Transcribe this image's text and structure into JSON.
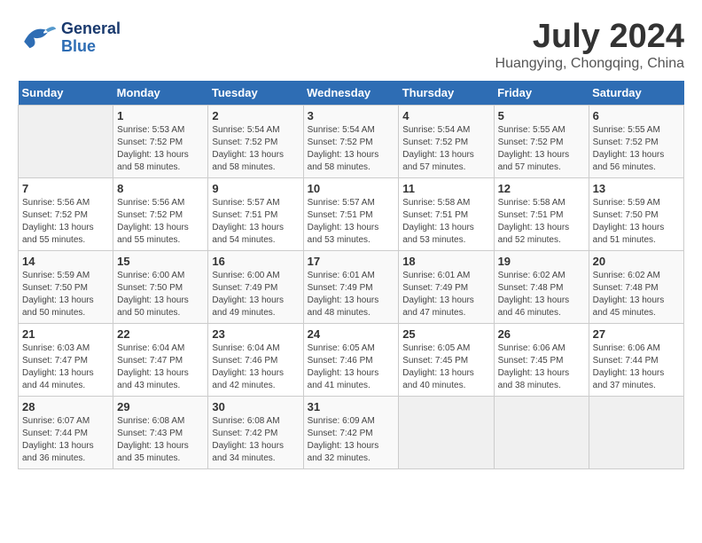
{
  "header": {
    "logo_general": "General",
    "logo_blue": "Blue",
    "month": "July 2024",
    "location": "Huangying, Chongqing, China"
  },
  "weekdays": [
    "Sunday",
    "Monday",
    "Tuesday",
    "Wednesday",
    "Thursday",
    "Friday",
    "Saturday"
  ],
  "weeks": [
    [
      {
        "day": "",
        "info": ""
      },
      {
        "day": "1",
        "info": "Sunrise: 5:53 AM\nSunset: 7:52 PM\nDaylight: 13 hours\nand 58 minutes."
      },
      {
        "day": "2",
        "info": "Sunrise: 5:54 AM\nSunset: 7:52 PM\nDaylight: 13 hours\nand 58 minutes."
      },
      {
        "day": "3",
        "info": "Sunrise: 5:54 AM\nSunset: 7:52 PM\nDaylight: 13 hours\nand 58 minutes."
      },
      {
        "day": "4",
        "info": "Sunrise: 5:54 AM\nSunset: 7:52 PM\nDaylight: 13 hours\nand 57 minutes."
      },
      {
        "day": "5",
        "info": "Sunrise: 5:55 AM\nSunset: 7:52 PM\nDaylight: 13 hours\nand 57 minutes."
      },
      {
        "day": "6",
        "info": "Sunrise: 5:55 AM\nSunset: 7:52 PM\nDaylight: 13 hours\nand 56 minutes."
      }
    ],
    [
      {
        "day": "7",
        "info": "Sunrise: 5:56 AM\nSunset: 7:52 PM\nDaylight: 13 hours\nand 55 minutes."
      },
      {
        "day": "8",
        "info": "Sunrise: 5:56 AM\nSunset: 7:52 PM\nDaylight: 13 hours\nand 55 minutes."
      },
      {
        "day": "9",
        "info": "Sunrise: 5:57 AM\nSunset: 7:51 PM\nDaylight: 13 hours\nand 54 minutes."
      },
      {
        "day": "10",
        "info": "Sunrise: 5:57 AM\nSunset: 7:51 PM\nDaylight: 13 hours\nand 53 minutes."
      },
      {
        "day": "11",
        "info": "Sunrise: 5:58 AM\nSunset: 7:51 PM\nDaylight: 13 hours\nand 53 minutes."
      },
      {
        "day": "12",
        "info": "Sunrise: 5:58 AM\nSunset: 7:51 PM\nDaylight: 13 hours\nand 52 minutes."
      },
      {
        "day": "13",
        "info": "Sunrise: 5:59 AM\nSunset: 7:50 PM\nDaylight: 13 hours\nand 51 minutes."
      }
    ],
    [
      {
        "day": "14",
        "info": "Sunrise: 5:59 AM\nSunset: 7:50 PM\nDaylight: 13 hours\nand 50 minutes."
      },
      {
        "day": "15",
        "info": "Sunrise: 6:00 AM\nSunset: 7:50 PM\nDaylight: 13 hours\nand 50 minutes."
      },
      {
        "day": "16",
        "info": "Sunrise: 6:00 AM\nSunset: 7:49 PM\nDaylight: 13 hours\nand 49 minutes."
      },
      {
        "day": "17",
        "info": "Sunrise: 6:01 AM\nSunset: 7:49 PM\nDaylight: 13 hours\nand 48 minutes."
      },
      {
        "day": "18",
        "info": "Sunrise: 6:01 AM\nSunset: 7:49 PM\nDaylight: 13 hours\nand 47 minutes."
      },
      {
        "day": "19",
        "info": "Sunrise: 6:02 AM\nSunset: 7:48 PM\nDaylight: 13 hours\nand 46 minutes."
      },
      {
        "day": "20",
        "info": "Sunrise: 6:02 AM\nSunset: 7:48 PM\nDaylight: 13 hours\nand 45 minutes."
      }
    ],
    [
      {
        "day": "21",
        "info": "Sunrise: 6:03 AM\nSunset: 7:47 PM\nDaylight: 13 hours\nand 44 minutes."
      },
      {
        "day": "22",
        "info": "Sunrise: 6:04 AM\nSunset: 7:47 PM\nDaylight: 13 hours\nand 43 minutes."
      },
      {
        "day": "23",
        "info": "Sunrise: 6:04 AM\nSunset: 7:46 PM\nDaylight: 13 hours\nand 42 minutes."
      },
      {
        "day": "24",
        "info": "Sunrise: 6:05 AM\nSunset: 7:46 PM\nDaylight: 13 hours\nand 41 minutes."
      },
      {
        "day": "25",
        "info": "Sunrise: 6:05 AM\nSunset: 7:45 PM\nDaylight: 13 hours\nand 40 minutes."
      },
      {
        "day": "26",
        "info": "Sunrise: 6:06 AM\nSunset: 7:45 PM\nDaylight: 13 hours\nand 38 minutes."
      },
      {
        "day": "27",
        "info": "Sunrise: 6:06 AM\nSunset: 7:44 PM\nDaylight: 13 hours\nand 37 minutes."
      }
    ],
    [
      {
        "day": "28",
        "info": "Sunrise: 6:07 AM\nSunset: 7:44 PM\nDaylight: 13 hours\nand 36 minutes."
      },
      {
        "day": "29",
        "info": "Sunrise: 6:08 AM\nSunset: 7:43 PM\nDaylight: 13 hours\nand 35 minutes."
      },
      {
        "day": "30",
        "info": "Sunrise: 6:08 AM\nSunset: 7:42 PM\nDaylight: 13 hours\nand 34 minutes."
      },
      {
        "day": "31",
        "info": "Sunrise: 6:09 AM\nSunset: 7:42 PM\nDaylight: 13 hours\nand 32 minutes."
      },
      {
        "day": "",
        "info": ""
      },
      {
        "day": "",
        "info": ""
      },
      {
        "day": "",
        "info": ""
      }
    ]
  ]
}
